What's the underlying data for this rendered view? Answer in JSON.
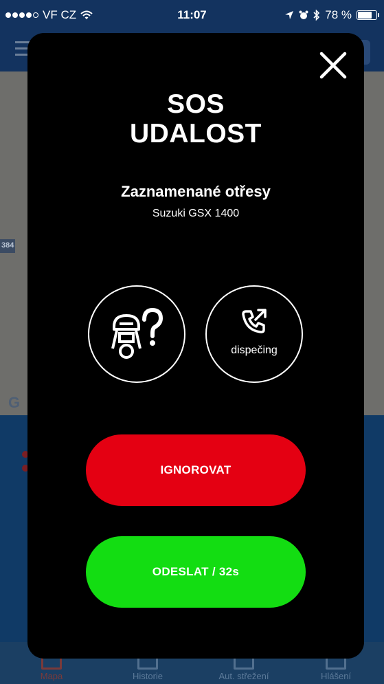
{
  "status_bar": {
    "carrier": "VF CZ",
    "time": "11:07",
    "battery": "78 %",
    "battery_level": 0.78
  },
  "background_app": {
    "road_label": "384",
    "map_logo": "G",
    "tabs": [
      {
        "label": "Mapa",
        "active": true
      },
      {
        "label": "Historie",
        "active": false
      },
      {
        "label": "Aut. střežení",
        "active": false
      },
      {
        "label": "Hlášení",
        "active": false
      }
    ]
  },
  "modal": {
    "title_line1": "SOS",
    "title_line2": "UDALOST",
    "subtitle": "Zaznamenané otřesy",
    "vehicle": "Suzuki GSX 1400",
    "dispatch_label": "dispečing",
    "ignore_label": "IGNOROVAT",
    "send_label": "ODESLAT / 32s"
  },
  "colors": {
    "ignore": "#e40012",
    "send": "#13dd12",
    "modal_bg": "#000000"
  },
  "icons": [
    "close-icon",
    "rider-question-icon",
    "phone-outgoing-icon",
    "wifi-icon",
    "location-arrow-icon",
    "alarm-icon",
    "bluetooth-icon",
    "battery-icon"
  ]
}
